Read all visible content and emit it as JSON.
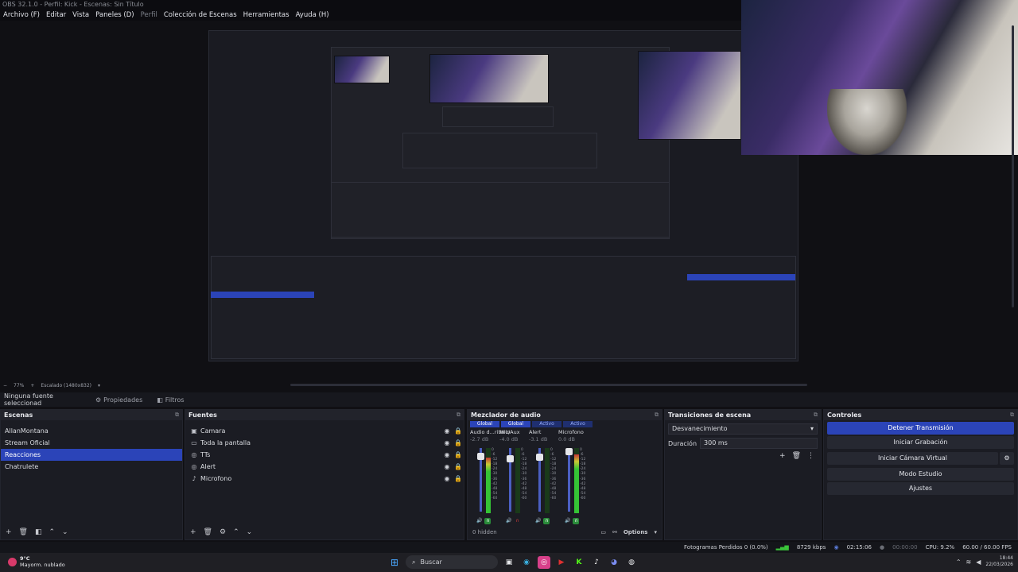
{
  "window": {
    "title": "OBS 32.1.0 - Perfil: Kick - Escenas: Sin Título"
  },
  "menu": [
    {
      "label": "Archivo (F)",
      "enabled": true
    },
    {
      "label": "Editar",
      "enabled": true
    },
    {
      "label": "Vista",
      "enabled": true
    },
    {
      "label": "Paneles (D)",
      "enabled": true
    },
    {
      "label": "Perfil",
      "enabled": false
    },
    {
      "label": "Colección de Escenas",
      "enabled": true
    },
    {
      "label": "Herramientas",
      "enabled": true
    },
    {
      "label": "Ayuda (H)",
      "enabled": true
    }
  ],
  "preview": {
    "zoom": "77%",
    "canvas_label": "Escalado (1480x832)"
  },
  "toolbar": {
    "no_source": "Ninguna fuente seleccionad",
    "properties": "Propiedades",
    "filters": "Filtros"
  },
  "scenes": {
    "title": "Escenas",
    "items": [
      {
        "label": "AllanMontana",
        "selected": false
      },
      {
        "label": "Stream Oficial",
        "selected": false
      },
      {
        "label": "Reacciones",
        "selected": true
      },
      {
        "label": "Chatrulete",
        "selected": false
      }
    ]
  },
  "sources": {
    "title": "Fuentes",
    "items": [
      {
        "label": "Camara",
        "icon": "camera-icon"
      },
      {
        "label": "Toda la pantalla",
        "icon": "monitor-icon"
      },
      {
        "label": "TTs",
        "icon": "globe-icon"
      },
      {
        "label": "Alert",
        "icon": "globe-icon"
      },
      {
        "label": "Microfono",
        "icon": "microphone-icon"
      }
    ]
  },
  "mixer": {
    "title": "Mezclador de audio",
    "tabs": [
      "Global",
      "Global",
      "Activo",
      "Activo"
    ],
    "channels": [
      {
        "name": "Audio d...ritorio",
        "db": "-2.7 dB",
        "fader": 0.92,
        "level": 0.85,
        "monitor": "on"
      },
      {
        "name": "Mic/Aux",
        "db": "-4.0 dB",
        "fader": 0.88,
        "level": 0.0,
        "monitor": "off"
      },
      {
        "name": "Alert",
        "db": "-3.1 dB",
        "fader": 0.9,
        "level": 0.0,
        "monitor": "on"
      },
      {
        "name": "Microfono",
        "db": "0.0 dB",
        "fader": 1.0,
        "level": 0.9,
        "monitor": "on"
      }
    ],
    "scale": [
      "0",
      "-6",
      "-12",
      "-18",
      "-24",
      "-30",
      "-36",
      "-42",
      "-48",
      "-54",
      "-60"
    ],
    "hidden": "0 hidden",
    "options": "Options"
  },
  "transitions": {
    "title": "Transiciones de escena",
    "selected": "Desvanecimiento",
    "duration_label": "Duración",
    "duration_value": "300 ms"
  },
  "controls": {
    "title": "Controles",
    "stop_stream": "Detener Transmisión",
    "start_recording": "Iniciar Grabación",
    "start_virtual_cam": "Iniciar Cámara Virtual",
    "studio_mode": "Modo Estudio",
    "settings": "Ajustes"
  },
  "status": {
    "dropped": "Fotogramas Perdidos 0 (0.0%)",
    "bitrate": "8729 kbps",
    "stream_time": "02:15:06",
    "rec_time": "00:00:00",
    "cpu": "CPU: 9.2%",
    "fps": "60.00 / 60.00 FPS"
  },
  "taskbar": {
    "weather_temp": "9°C",
    "weather_desc": "Mayorm. nublado",
    "search": "Buscar",
    "time": "18:44",
    "date": "22/03/2026"
  }
}
